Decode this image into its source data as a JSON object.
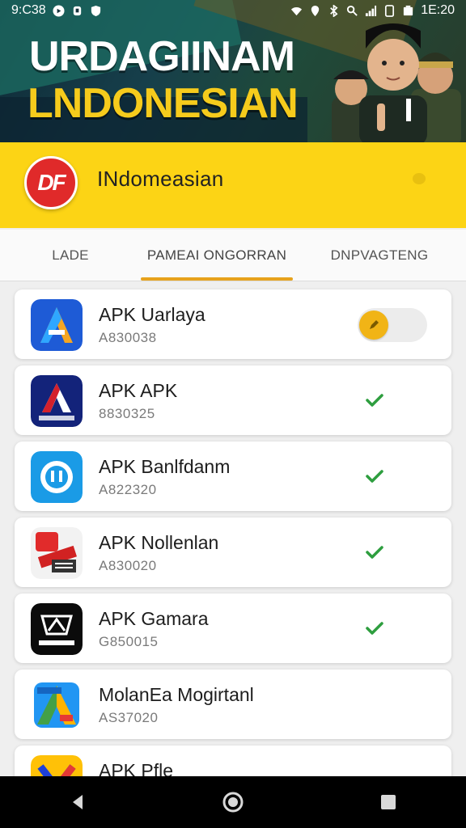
{
  "status_bar": {
    "time": "9:C38",
    "battery": "100%",
    "clock_right": "1E:20"
  },
  "banner": {
    "title": "URDAGIINAM",
    "subtitle": "LNDONESIAN"
  },
  "app_header": {
    "logo_text": "DF",
    "name": "INdomeasian"
  },
  "tabs": [
    {
      "label": "LADE"
    },
    {
      "label": "PAMEAI ONGORRAN",
      "active": true
    },
    {
      "label": "DNPVAGTENG"
    }
  ],
  "apps": [
    {
      "title": "APK Uarlaya",
      "code": "A830038",
      "status": "toggle",
      "icon": "blue-a-icon"
    },
    {
      "title": "APK APK",
      "code": "8830325",
      "status": "check",
      "icon": "navy-a-icon"
    },
    {
      "title": "APK Banlfdanm",
      "code": "A822320",
      "status": "check",
      "icon": "headset-icon"
    },
    {
      "title": "APK Nollenlan",
      "code": "A830020",
      "status": "check",
      "icon": "red-badge-icon"
    },
    {
      "title": "APK Gamara",
      "code": "G850015",
      "status": "check",
      "icon": "crown-icon"
    },
    {
      "title": "MolanEa Mogirtanl",
      "code": "AS37020",
      "status": "none",
      "icon": "colorful-a-icon"
    },
    {
      "title": "APK Pfle",
      "code": "",
      "status": "none",
      "icon": "yellow-arrow-icon"
    }
  ],
  "colors": {
    "header_yellow": "#fcd415",
    "tab_indicator": "#e7a21c",
    "check_green": "#2e9e3f",
    "toggle_knob": "#f1b416"
  }
}
